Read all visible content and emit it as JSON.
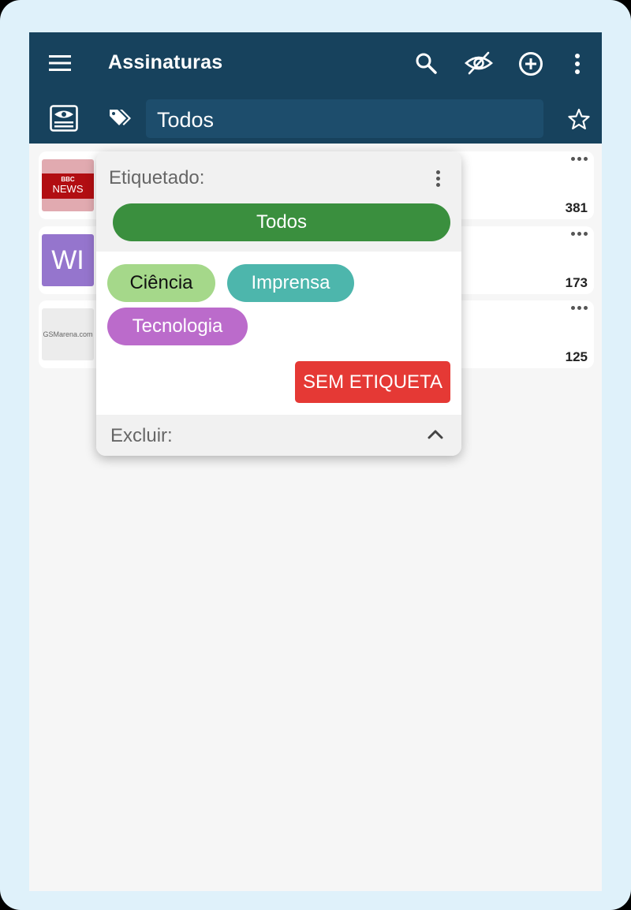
{
  "appbar": {
    "title": "Assinaturas",
    "icons": [
      "menu-icon",
      "search-icon",
      "eye-off-icon",
      "add-circle-icon",
      "more-vert-icon",
      "list-view-icon",
      "tag-icon",
      "star-outline-icon"
    ],
    "tag_field_value": "Todos",
    "background": "#17425d"
  },
  "subscriptions": [
    {
      "thumb_text_top": "BBC",
      "thumb_text_bottom": "NEWS",
      "count": "381"
    },
    {
      "thumb_text": "WI",
      "count": "173"
    },
    {
      "thumb_text": "GSMarena.com",
      "count": "125"
    }
  ],
  "tag_popup": {
    "tagged_label": "Etiquetado:",
    "all_button": "Todos",
    "tags": [
      {
        "label": "Ciência",
        "color": "#a5d88a"
      },
      {
        "label": "Imprensa",
        "color": "#4db6ac"
      },
      {
        "label": "Tecnologia",
        "color": "#bb6bcb"
      }
    ],
    "untagged_button": "SEM ETIQUETA",
    "exclude_label": "Excluir:",
    "colors": {
      "all": "#3a8f3e",
      "untagged": "#e53935"
    }
  }
}
